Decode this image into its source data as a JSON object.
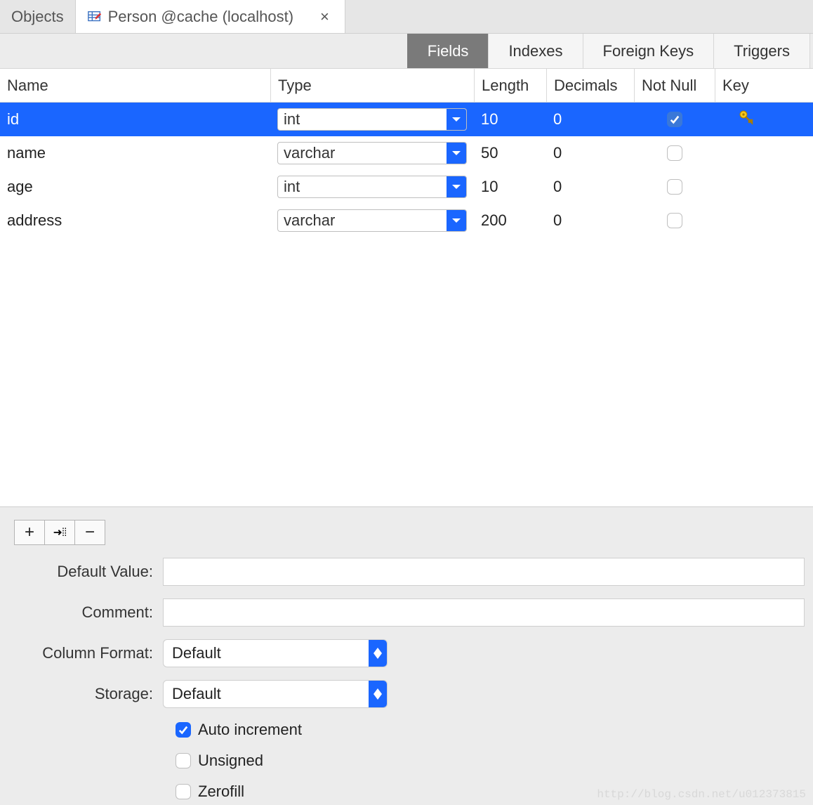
{
  "tabs": {
    "objects_label": "Objects",
    "active_label": "Person @cache (localhost)",
    "close_glyph": "×"
  },
  "subtabs": [
    {
      "id": "fields",
      "label": "Fields",
      "active": true
    },
    {
      "id": "indexes",
      "label": "Indexes",
      "active": false
    },
    {
      "id": "fkeys",
      "label": "Foreign Keys",
      "active": false
    },
    {
      "id": "trig",
      "label": "Triggers",
      "active": false
    }
  ],
  "columns": {
    "name": "Name",
    "type": "Type",
    "length": "Length",
    "decimals": "Decimals",
    "notnull": "Not Null",
    "key": "Key"
  },
  "rows": [
    {
      "name": "id",
      "type": "int",
      "length": "10",
      "decimals": "0",
      "notnull": true,
      "key": true,
      "selected": true
    },
    {
      "name": "name",
      "type": "varchar",
      "length": "50",
      "decimals": "0",
      "notnull": false,
      "key": false,
      "selected": false
    },
    {
      "name": "age",
      "type": "int",
      "length": "10",
      "decimals": "0",
      "notnull": false,
      "key": false,
      "selected": false
    },
    {
      "name": "address",
      "type": "varchar",
      "length": "200",
      "decimals": "0",
      "notnull": false,
      "key": false,
      "selected": false
    }
  ],
  "toolbar": {
    "add_glyph": "+",
    "remove_glyph": "−"
  },
  "form": {
    "default_label": "Default Value:",
    "default_value": "",
    "comment_label": "Comment:",
    "comment_value": "",
    "colfmt_label": "Column Format:",
    "colfmt_value": "Default",
    "storage_label": "Storage:",
    "storage_value": "Default",
    "autoinc_label": "Auto increment",
    "autoinc_on": true,
    "unsigned_label": "Unsigned",
    "unsigned_on": false,
    "zerofill_label": "Zerofill",
    "zerofill_on": false
  },
  "watermark": "http://blog.csdn.net/u012373815"
}
